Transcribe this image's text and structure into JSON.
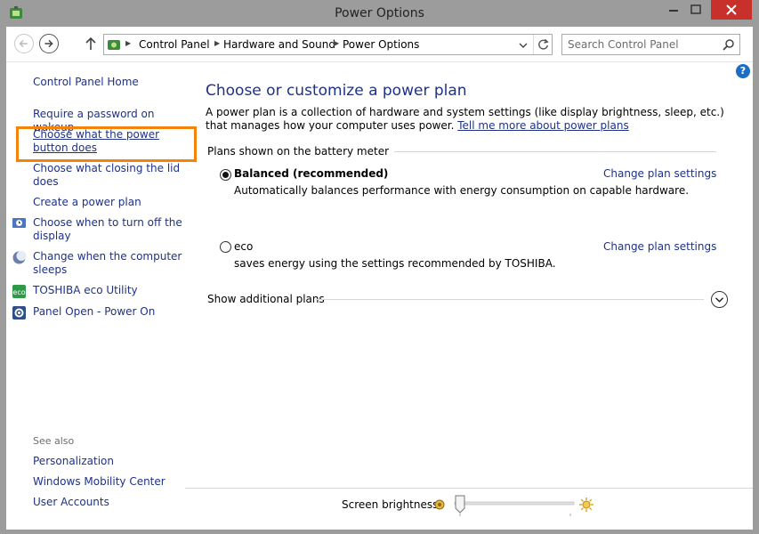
{
  "window": {
    "title": "Power Options"
  },
  "address": {
    "crumbs": [
      "Control Panel",
      "Hardware and Sound",
      "Power Options"
    ]
  },
  "search": {
    "placeholder": "Search Control Panel"
  },
  "sidebar": {
    "home": "Control Panel Home",
    "tasks": [
      "Require a password on wakeup",
      "Choose what the power button does",
      "Choose what closing the lid does",
      "Create a power plan",
      "Choose when to turn off the display",
      "Change when the computer sleeps",
      "TOSHIBA eco Utility",
      "Panel Open - Power On"
    ],
    "see_also_label": "See also",
    "see_also": [
      "Personalization",
      "Windows Mobility Center",
      "User Accounts"
    ]
  },
  "main": {
    "heading": "Choose or customize a power plan",
    "description": "A power plan is a collection of hardware and system settings (like display brightness, sleep, etc.) that manages how your computer uses power. ",
    "description_link": "Tell me more about power plans",
    "group_label": "Plans shown on the battery meter",
    "plans": [
      {
        "name": "Balanced (recommended)",
        "description": "Automatically balances performance with energy consumption on capable hardware.",
        "link": "Change plan settings",
        "selected": true
      },
      {
        "name": "eco",
        "description": "saves energy using the settings recommended by TOSHIBA.",
        "link": "Change plan settings",
        "selected": false
      }
    ],
    "show_additional": "Show additional plans"
  },
  "footer": {
    "brightness_label": "Screen brightness:",
    "brightness_level": 0
  },
  "colors": {
    "link": "#1e3287",
    "highlight": "#f5820b",
    "close_button": "#c7302b"
  }
}
